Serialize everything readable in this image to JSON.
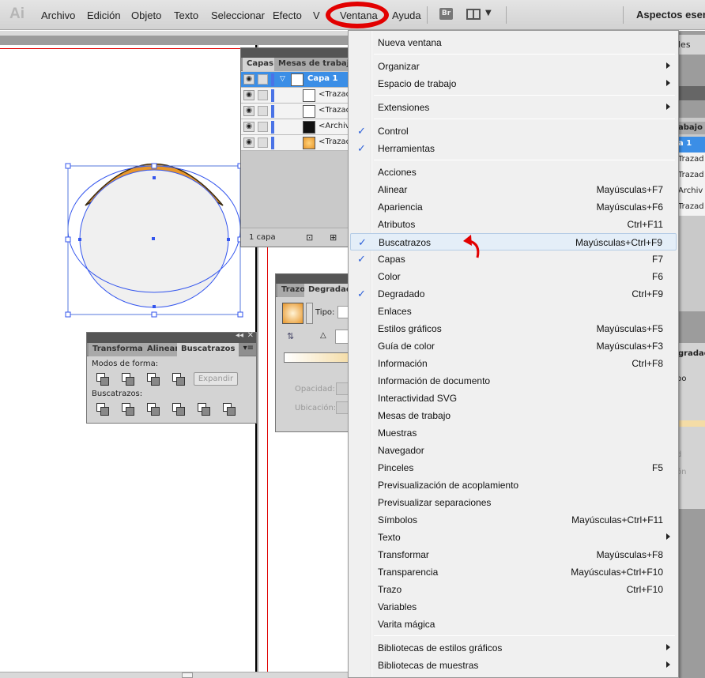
{
  "menubar": {
    "logo": "Ai",
    "items": [
      "Archivo",
      "Edición",
      "Objeto",
      "Texto",
      "Seleccionar",
      "Efecto",
      "V",
      "Ventana",
      "Ayuda"
    ],
    "br_label": "Br",
    "workspace": "Aspectos esenci"
  },
  "layers_panel": {
    "tabs": [
      "Capas",
      "Mesas de trabajo"
    ],
    "rows": [
      {
        "name": "Capa 1",
        "selected": true
      },
      {
        "name": "<Trazad"
      },
      {
        "name": "<Trazad"
      },
      {
        "name": "<Archiv"
      },
      {
        "name": "<Trazad"
      }
    ],
    "footer": "1 capa"
  },
  "pathfinder_panel": {
    "tabs": [
      "Transformar",
      "Alinear",
      "Buscatrazos"
    ],
    "shape_modes_label": "Modos de forma:",
    "expand_label": "Expandir",
    "pathfinders_label": "Buscatrazos:"
  },
  "gradient_panel": {
    "tabs": [
      "Trazo",
      "Degradad"
    ],
    "type_label": "Tipo:",
    "opacity_label": "Opacidad:",
    "location_label": "Ubicación:"
  },
  "right_panels": {
    "dropdown_text": "les",
    "tab": "abajo",
    "rows": [
      "a 1",
      "Trazad",
      "Trazad",
      "Archiv",
      "Trazad"
    ],
    "grad_tab": "gradad",
    "tipo": "po",
    "dad": "d",
    "cion": "ón"
  },
  "window_menu": {
    "items": [
      {
        "label": "Nueva ventana"
      },
      {
        "sep": true
      },
      {
        "label": "Organizar",
        "submenu": true
      },
      {
        "label": "Espacio de trabajo",
        "submenu": true
      },
      {
        "sep": true
      },
      {
        "label": "Extensiones",
        "submenu": true
      },
      {
        "sep": true
      },
      {
        "label": "Control",
        "checked": true
      },
      {
        "label": "Herramientas",
        "checked": true
      },
      {
        "sep": true
      },
      {
        "label": "Acciones"
      },
      {
        "label": "Alinear",
        "shortcut": "Mayúsculas+F7"
      },
      {
        "label": "Apariencia",
        "shortcut": "Mayúsculas+F6"
      },
      {
        "label": "Atributos",
        "shortcut": "Ctrl+F11"
      },
      {
        "label": "Buscatrazos",
        "shortcut": "Mayúsculas+Ctrl+F9",
        "checked": true,
        "highlighted": true
      },
      {
        "label": "Capas",
        "shortcut": "F7",
        "checked": true
      },
      {
        "label": "Color",
        "shortcut": "F6"
      },
      {
        "label": "Degradado",
        "shortcut": "Ctrl+F9",
        "checked": true
      },
      {
        "label": "Enlaces"
      },
      {
        "label": "Estilos gráficos",
        "shortcut": "Mayúsculas+F5"
      },
      {
        "label": "Guía de color",
        "shortcut": "Mayúsculas+F3"
      },
      {
        "label": "Información",
        "shortcut": "Ctrl+F8"
      },
      {
        "label": "Información de documento"
      },
      {
        "label": "Interactividad SVG"
      },
      {
        "label": "Mesas de trabajo"
      },
      {
        "label": "Muestras"
      },
      {
        "label": "Navegador"
      },
      {
        "label": "Pinceles",
        "shortcut": "F5"
      },
      {
        "label": "Previsualización de acoplamiento"
      },
      {
        "label": "Previsualizar separaciones"
      },
      {
        "label": "Símbolos",
        "shortcut": "Mayúsculas+Ctrl+F11"
      },
      {
        "label": "Texto",
        "submenu": true
      },
      {
        "label": "Transformar",
        "shortcut": "Mayúsculas+F8"
      },
      {
        "label": "Transparencia",
        "shortcut": "Mayúsculas+Ctrl+F10"
      },
      {
        "label": "Trazo",
        "shortcut": "Ctrl+F10"
      },
      {
        "label": "Variables"
      },
      {
        "label": "Varita mágica"
      },
      {
        "sep": true
      },
      {
        "label": "Bibliotecas de estilos gráficos",
        "submenu": true
      },
      {
        "label": "Bibliotecas de muestras",
        "submenu": true
      }
    ]
  },
  "colors": {
    "annotation_red": "#e20000",
    "selection_blue": "#3b8ee6",
    "check_blue": "#2b5fd9",
    "ellipse_fill": "#f0f0f0",
    "ellipse_stroke": "#3355ee",
    "orange_shape": "#e8962a"
  }
}
